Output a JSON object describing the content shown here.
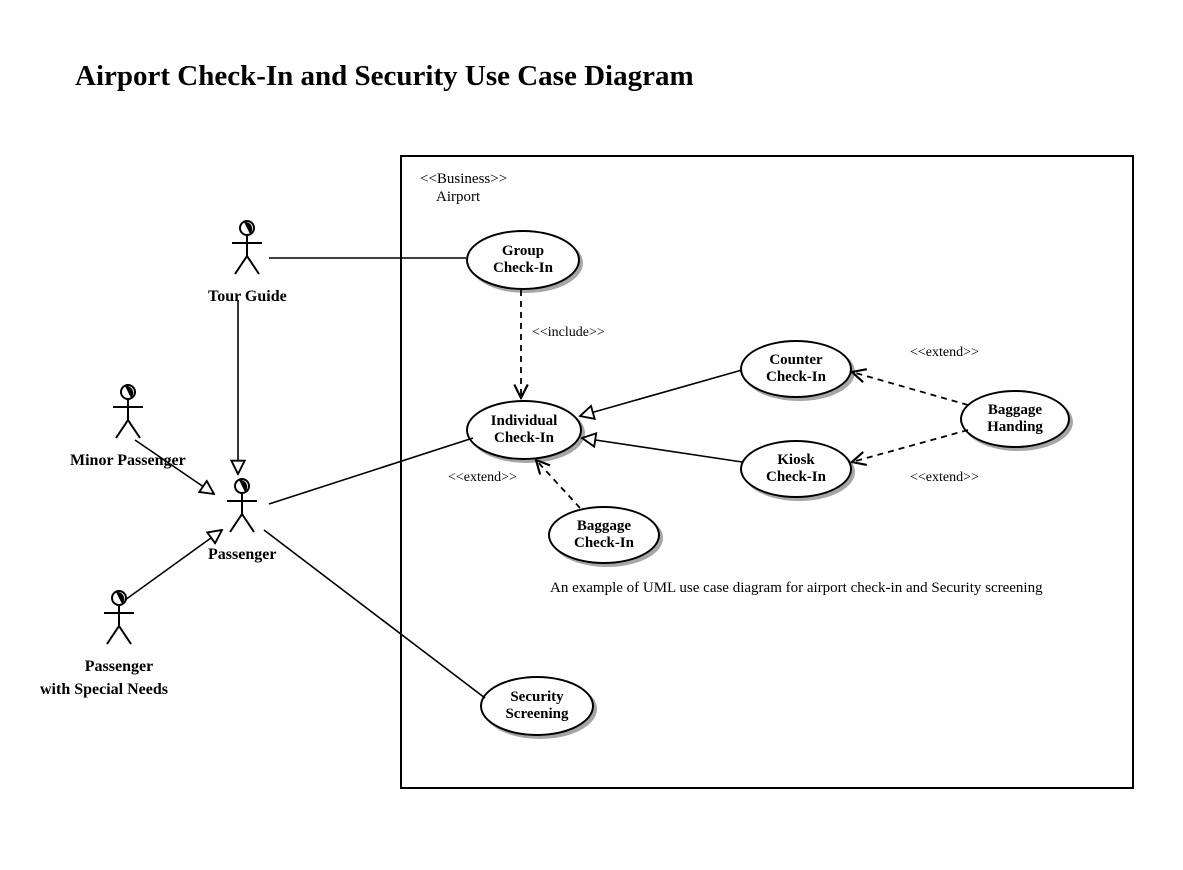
{
  "title": "Airport Check-In and Security Use Case Diagram",
  "system": {
    "stereotype": "<<Business>>",
    "name": "Airport"
  },
  "actors": {
    "tourGuide": "Tour Guide",
    "minorPassenger": "Minor Passenger",
    "passenger": "Passenger",
    "passengerSpecial1": "Passenger",
    "passengerSpecial2": "with Special Needs"
  },
  "usecases": {
    "groupCheckIn1": "Group",
    "groupCheckIn2": "Check-In",
    "individualCheckIn1": "Individual",
    "individualCheckIn2": "Check-In",
    "counterCheckIn1": "Counter",
    "counterCheckIn2": "Check-In",
    "kioskCheckIn1": "Kiosk",
    "kioskCheckIn2": "Check-In",
    "baggageHanding1": "Baggage",
    "baggageHanding2": "Handing",
    "baggageCheckIn1": "Baggage",
    "baggageCheckIn2": "Check-In",
    "securityScreening1": "Security",
    "securityScreening2": "Screening"
  },
  "relations": {
    "include": "<<include>>",
    "extend": "<<extend>>"
  },
  "caption": "An example of UML use case diagram for airport check-in and Security screening"
}
